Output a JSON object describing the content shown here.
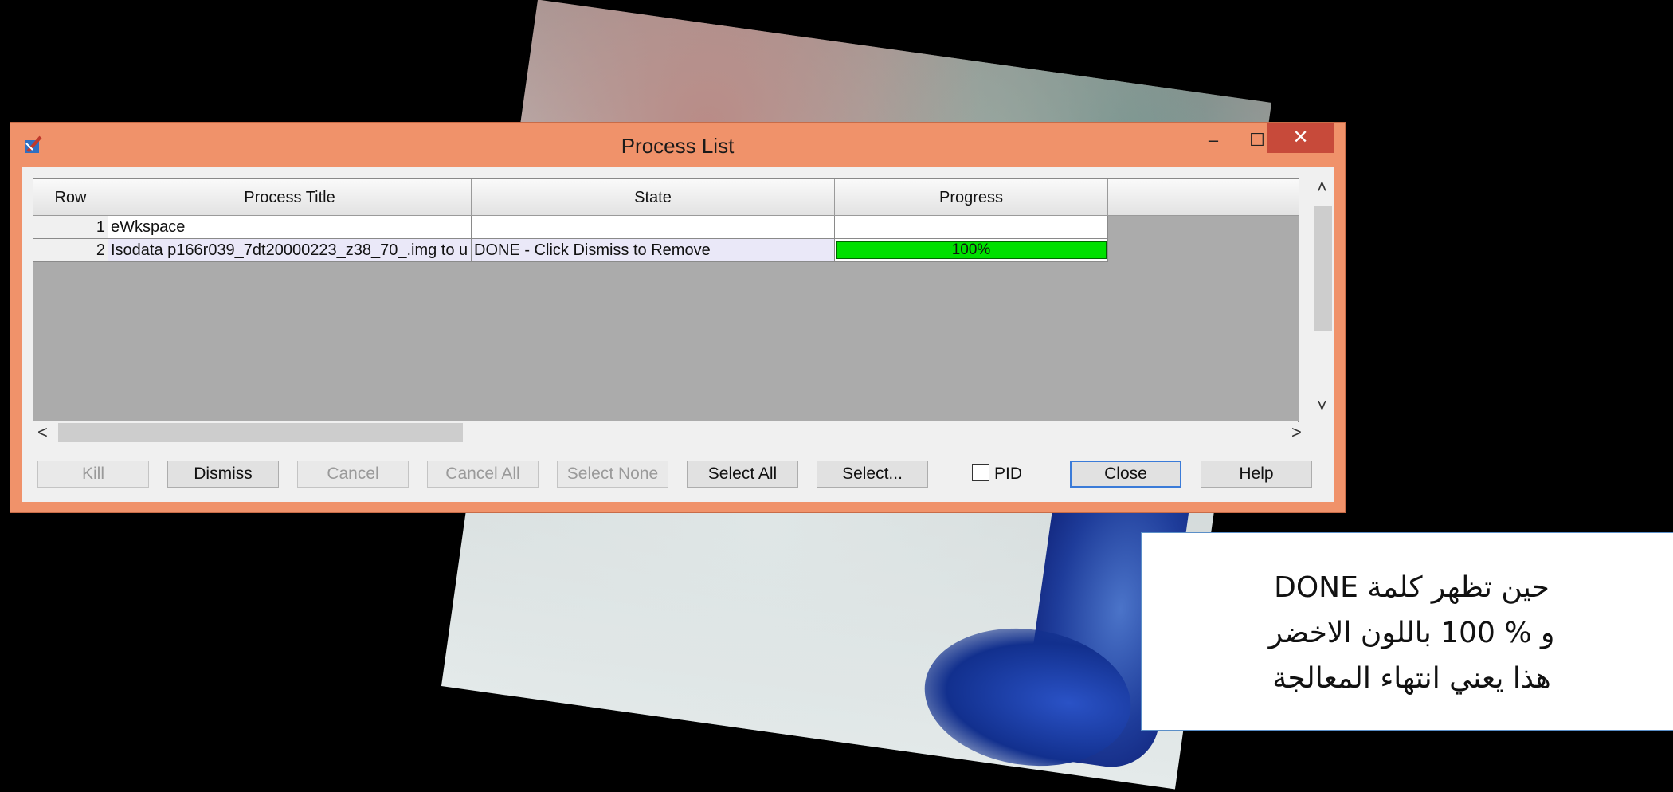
{
  "window": {
    "title": "Process List",
    "controls": {
      "minimize": "‒",
      "maximize": "☐",
      "close": "✕"
    }
  },
  "table": {
    "columns": [
      "Row",
      "Process Title",
      "State",
      "Progress"
    ],
    "rows": [
      {
        "row": "1",
        "title": "eWkspace",
        "state": "",
        "progress": ""
      },
      {
        "row": "2",
        "title": "Isodata p166r039_7dt20000223_z38_70_.img to u",
        "state": "DONE - Click Dismiss to Remove",
        "progress": "100%"
      }
    ],
    "progress_value": 1.0
  },
  "scroll": {
    "up": "˄",
    "down": "˅",
    "left": "<",
    "right": ">"
  },
  "buttons": {
    "kill": "Kill",
    "dismiss": "Dismiss",
    "cancel": "Cancel",
    "cancel_all": "Cancel All",
    "select_none": "Select None",
    "select_all": "Select All",
    "select": "Select...",
    "pid": "PID",
    "close": "Close",
    "help": "Help"
  },
  "note": {
    "line1": "حين تظهر كلمة  DONE",
    "line2": "و % 100 باللون الاخضر",
    "line3": "هذا يعني انتهاء المعالجة"
  },
  "colors": {
    "titlebar": "#f0926a",
    "progress_fill": "#00e000",
    "close_button": "#c74a3a"
  }
}
